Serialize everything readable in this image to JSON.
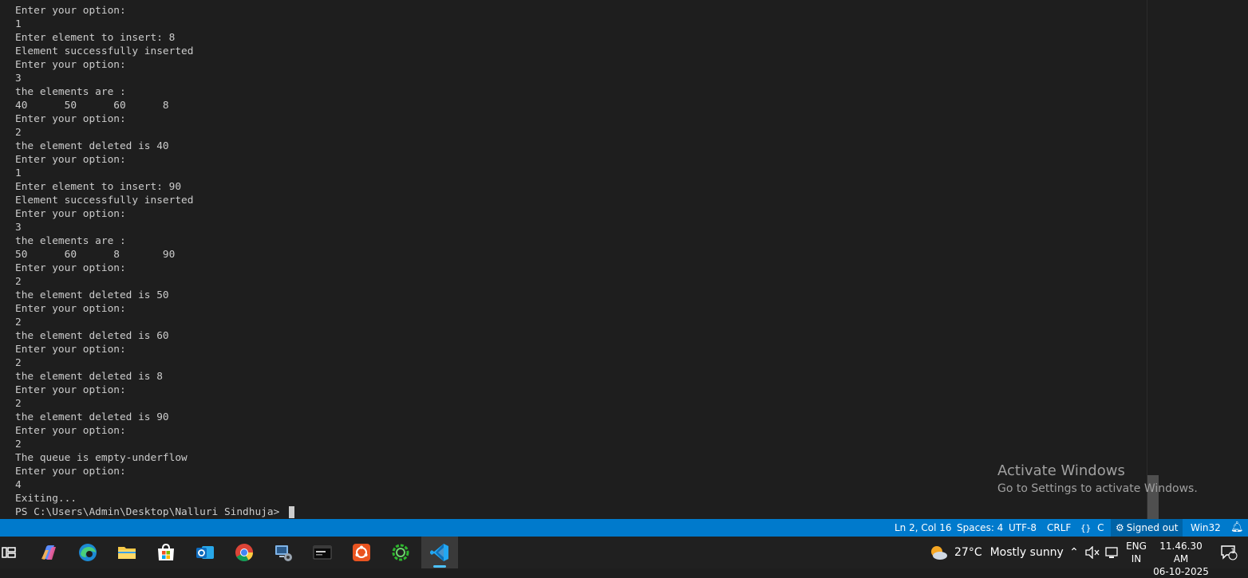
{
  "terminal": {
    "lines": [
      "Enter your option:",
      "1",
      "Enter element to insert: 8",
      "Element successfully inserted",
      "Enter your option:",
      "3",
      "the elements are :",
      "40      50      60      8",
      "Enter your option:",
      "2",
      "the element deleted is 40",
      "Enter your option:",
      "1",
      "Enter element to insert: 90",
      "Element successfully inserted",
      "Enter your option:",
      "3",
      "the elements are :",
      "50      60      8       90",
      "Enter your option:",
      "2",
      "the element deleted is 50",
      "Enter your option:",
      "2",
      "the element deleted is 60",
      "Enter your option:",
      "2",
      "the element deleted is 8",
      "Enter your option:",
      "2",
      "the element deleted is 90",
      "Enter your option:",
      "2",
      "The queue is empty-underflow",
      "Enter your option:",
      "4",
      "Exiting..."
    ],
    "prompt": "PS C:\\Users\\Admin\\Desktop\\Nalluri Sindhuja> "
  },
  "watermark": {
    "title": "Activate Windows",
    "subtitle": "Go to Settings to activate Windows."
  },
  "statusbar": {
    "position": "Ln 2, Col 16",
    "spaces": "Spaces: 4",
    "encoding": "UTF-8",
    "eol": "CRLF",
    "language": "C",
    "account": "Signed out",
    "platform": "Win32",
    "background_color": "#007acc"
  },
  "taskbar": {
    "apps": [
      {
        "name": "task-view-icon"
      },
      {
        "name": "copilot-icon"
      },
      {
        "name": "edge-icon"
      },
      {
        "name": "file-explorer-icon"
      },
      {
        "name": "microsoft-store-icon"
      },
      {
        "name": "outlook-icon"
      },
      {
        "name": "chrome-icon"
      },
      {
        "name": "control-panel-icon"
      },
      {
        "name": "terminal-app-icon"
      },
      {
        "name": "ubuntu-icon"
      },
      {
        "name": "loading-ring-app-icon"
      },
      {
        "name": "vscode-icon",
        "active": true
      }
    ],
    "weather": {
      "temp": "27°C",
      "desc": "Mostly sunny"
    },
    "lang": {
      "line1": "ENG",
      "line2": "IN"
    },
    "clock": {
      "time": "11.46.30 AM",
      "date": "06-10-2025"
    },
    "notification_count": "1"
  }
}
